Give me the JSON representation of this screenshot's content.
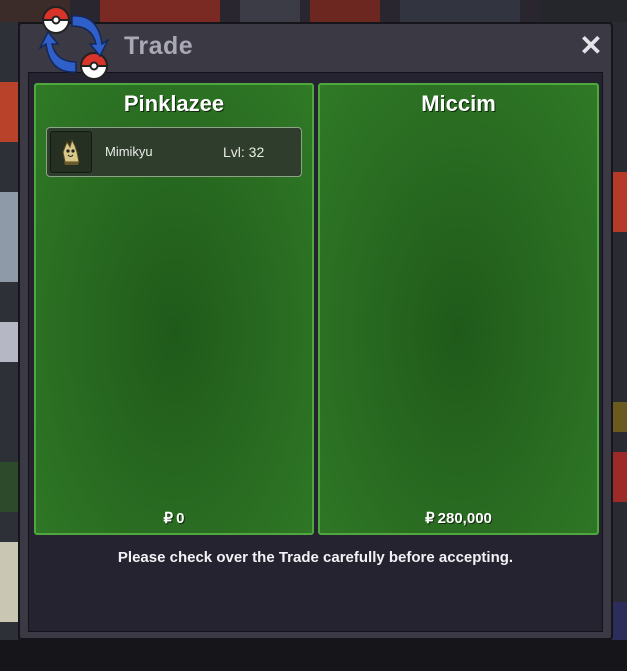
{
  "window": {
    "title": "Trade",
    "close_glyph": "✕"
  },
  "icons": {
    "logo": "trade-swap-pokeball-icon",
    "close": "close-icon",
    "currency": "pokedollar-icon"
  },
  "left_panel": {
    "player_name": "Pinklazee",
    "pokemon": [
      {
        "name": "Mimikyu",
        "level": "Lvl: 32"
      }
    ],
    "currency_symbol": "₽",
    "money": "0"
  },
  "right_panel": {
    "player_name": "Miccim",
    "pokemon": [],
    "currency_symbol": "₽",
    "money": "280,000"
  },
  "message": "Please check over the Trade carefully before accepting.",
  "colors": {
    "panel_green": "#2a6d22",
    "panel_border": "#4fa83e",
    "window_bg": "#3a3944"
  }
}
